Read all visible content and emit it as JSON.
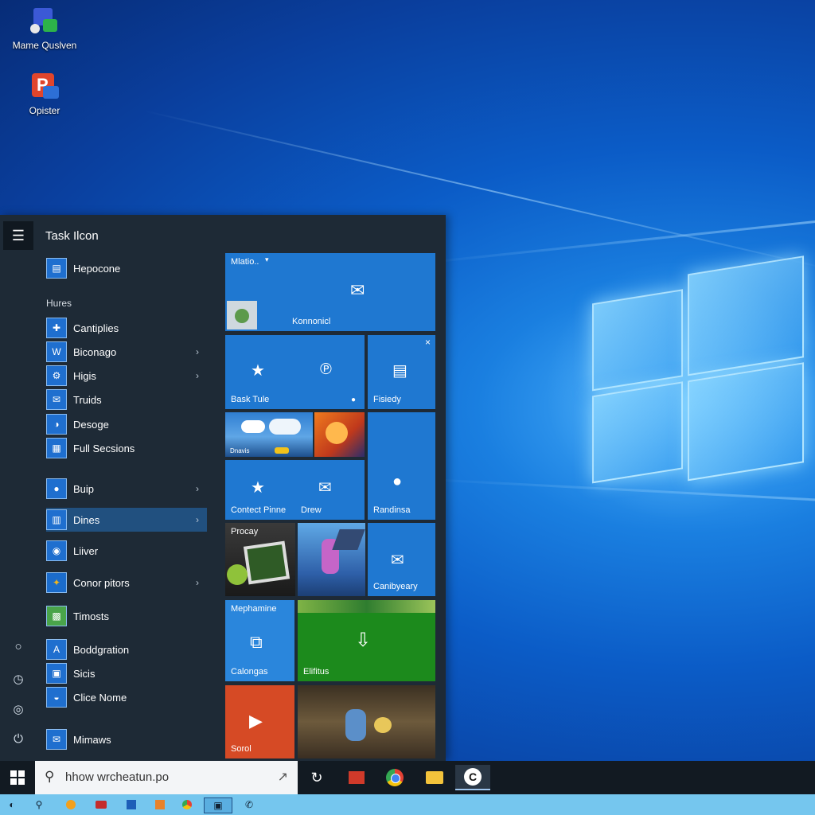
{
  "desktop": {
    "icons": [
      {
        "label": "Mame Quslven",
        "icon": "app-shortcut-icon"
      },
      {
        "label": "Opister",
        "icon": "presentation-app-icon"
      }
    ]
  },
  "start_menu": {
    "title": "Task Ilcon",
    "menu_icon": "hamburger-icon",
    "top_item": "Hepocone",
    "group_header": "Hures",
    "apps": [
      {
        "label": "Cantiplies",
        "arrow": ""
      },
      {
        "label": "Biconago",
        "arrow": "›"
      },
      {
        "label": "Higis",
        "arrow": "›"
      },
      {
        "label": "Truids",
        "arrow": ""
      },
      {
        "label": "Desoge",
        "arrow": ""
      },
      {
        "label": "Full Secsions",
        "arrow": ""
      },
      {
        "label": "Buip",
        "arrow": "›"
      },
      {
        "label": "Dines",
        "arrow": "›",
        "selected": true
      },
      {
        "label": "Liiver",
        "arrow": ""
      },
      {
        "label": "Conor pitors",
        "arrow": "›"
      },
      {
        "label": "Timosts",
        "arrow": ""
      },
      {
        "label": "Boddgration",
        "arrow": ""
      },
      {
        "label": "Sicis",
        "arrow": ""
      },
      {
        "label": "Clice Nome",
        "arrow": ""
      },
      {
        "label": "Mimaws",
        "arrow": ""
      }
    ],
    "rail_icons": [
      "search-icon",
      "clock-icon",
      "settings-icon",
      "power-icon"
    ]
  },
  "tiles": {
    "mail_top": "Mlatio..",
    "mail_caption": "Konnonicl",
    "bask_tule": "Bask Tule",
    "fisiedy": "Fisiedy",
    "weather_caption": "Dnavis",
    "contect_pinne": "Contect Pinne",
    "drew": "Drew",
    "randinsa": "Randinsa",
    "procay": "Procay",
    "canibyeary": "Canibyeary",
    "mephamine": "Mephamine",
    "calongas": "Calongas",
    "elifitus": "Elifitus",
    "sorol": "Sorol"
  },
  "taskbar": {
    "search_text": "hhow wrcheatun.po",
    "apps": [
      "task-view-icon",
      "media-app-icon",
      "chrome-icon",
      "file-explorer-icon",
      "active-app-icon"
    ]
  },
  "colors": {
    "tile_blue": "#1f78d1",
    "tile_green": "#1c8a1c",
    "tile_red": "#d64a25",
    "menu_bg": "#1e2a36"
  }
}
